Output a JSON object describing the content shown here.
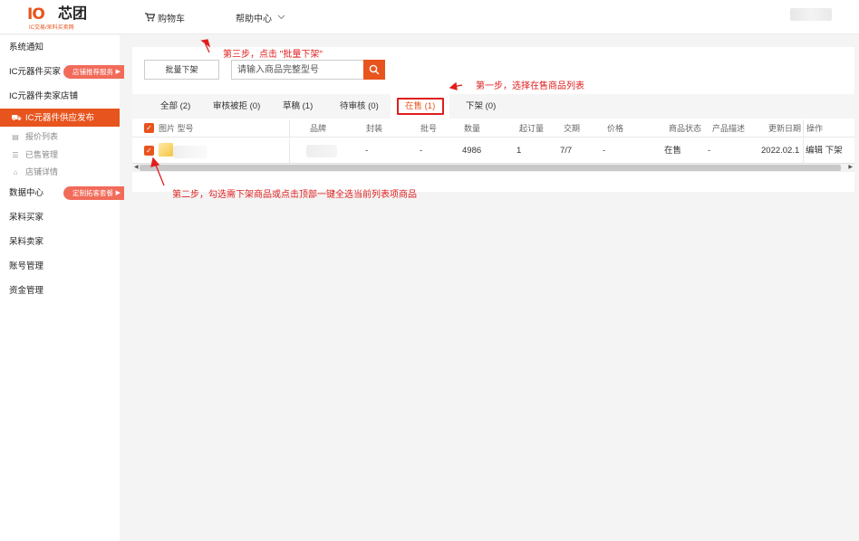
{
  "header": {
    "logo_mark": "IO",
    "logo_name": "芯团",
    "logo_slogan": "IC交易/呆料买卖网",
    "cart_label": "购物车",
    "help_label": "帮助中心"
  },
  "sidebar": {
    "items": [
      {
        "label": "系统通知"
      },
      {
        "label": "IC元器件买家"
      },
      {
        "label": "IC元器件卖家店铺"
      },
      {
        "label": "IC元器件供应发布"
      },
      {
        "label": "数据中心"
      },
      {
        "label": "呆料买家"
      },
      {
        "label": "呆料卖家"
      },
      {
        "label": "账号管理"
      },
      {
        "label": "资金管理"
      }
    ],
    "sub_items": [
      {
        "label": "报价列表"
      },
      {
        "label": "已售管理"
      },
      {
        "label": "店铺详情"
      }
    ],
    "tags": {
      "buyer_service": "店铺推荐服务",
      "data_package": "定制拓客套餐"
    }
  },
  "toolbar": {
    "batch_button": "批量下架",
    "search_placeholder": "请输入商品完整型号"
  },
  "tabs": [
    {
      "label": "全部 (2)"
    },
    {
      "label": "审核被拒 (0)"
    },
    {
      "label": "草稿 (1)"
    },
    {
      "label": "待审核 (0)"
    },
    {
      "label": "在售 (1)"
    },
    {
      "label": "下架 (0)"
    }
  ],
  "table": {
    "columns": [
      "图片 型号",
      "品牌",
      "封装",
      "批号",
      "数量",
      "起订量",
      "交期",
      "价格",
      "商品状态",
      "产品描述",
      "更新日期",
      "操作"
    ],
    "rows": [
      {
        "package": "-",
        "batch": "-",
        "quantity": "4986",
        "moq": "1",
        "lead_time": "7/7",
        "price": "-",
        "status": "在售",
        "description": "-",
        "updated": "2022.02.1",
        "op_edit": "编辑",
        "op_delist": "下架"
      }
    ]
  },
  "annotations": {
    "step1": "第一步，选择在售商品列表",
    "step2": "第二步，勾选需下架商品或点击顶部一键全选当前列表项商品",
    "step3": "第三步，点击 \"批量下架\""
  },
  "colors": {
    "accent": "#e8541e",
    "annotation": "#e01e1e",
    "tag": "#f26b5a"
  }
}
